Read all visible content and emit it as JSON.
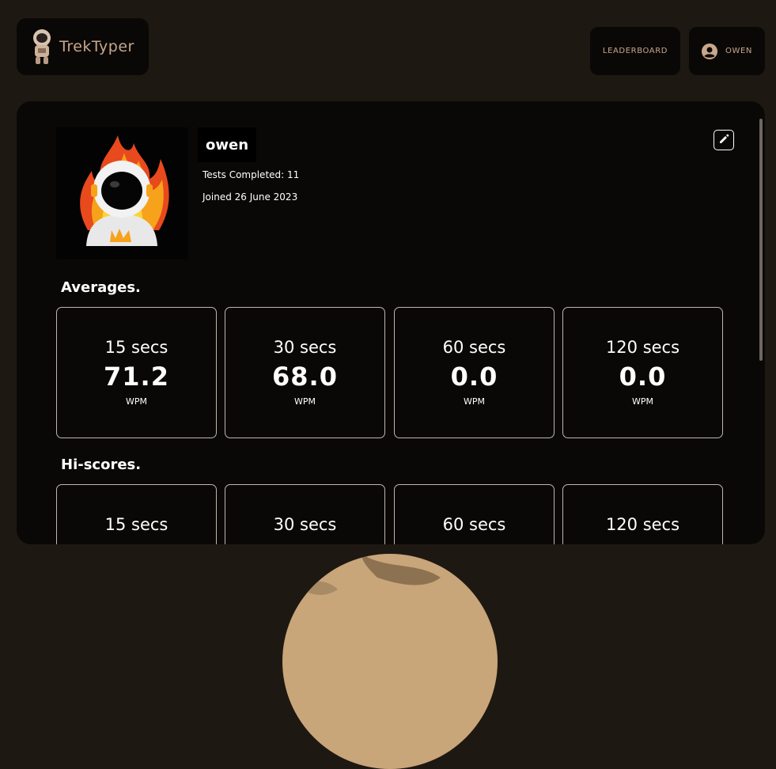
{
  "header": {
    "logo_text": "TrekTyper",
    "leaderboard_label": "LEADERBOARD",
    "user_label": "OWEN"
  },
  "profile": {
    "username": "owen",
    "tests_completed": "Tests Completed: 11",
    "joined": "Joined 26 June 2023"
  },
  "averages": {
    "title": "Averages.",
    "cards": [
      {
        "duration": "15 secs",
        "value": "71.2",
        "unit": "WPM"
      },
      {
        "duration": "30 secs",
        "value": "68.0",
        "unit": "WPM"
      },
      {
        "duration": "60 secs",
        "value": "0.0",
        "unit": "WPM"
      },
      {
        "duration": "120 secs",
        "value": "0.0",
        "unit": "WPM"
      }
    ]
  },
  "hiscores": {
    "title": "Hi-scores.",
    "cards": [
      {
        "duration": "15 secs"
      },
      {
        "duration": "30 secs"
      },
      {
        "duration": "60 secs"
      },
      {
        "duration": "120 secs"
      }
    ]
  },
  "colors": {
    "background": "#1e1812",
    "panel": "#0a0806",
    "accent": "#c9a78c",
    "card_border": "#bdb6ae"
  }
}
